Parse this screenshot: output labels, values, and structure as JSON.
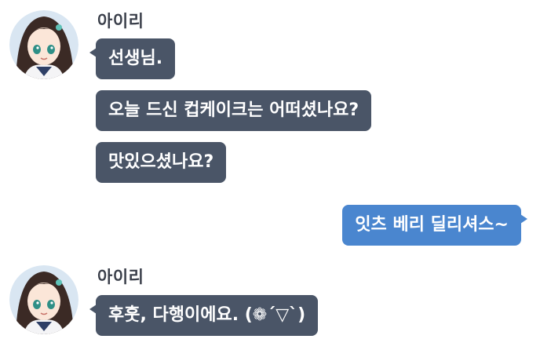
{
  "conversation": {
    "group1": {
      "sender": "아이리",
      "messages": [
        "선생님.",
        "오늘 드신 컵케이크는 어떠셨나요?",
        "맛있으셨나요?"
      ]
    },
    "reply": {
      "message": "잇츠 베리 딜리셔스~"
    },
    "group2": {
      "sender": "아이리",
      "messages": [
        "후훗, 다행이에요. (❁´▽`)"
      ]
    }
  },
  "colors": {
    "incoming_bubble": "#4a5567",
    "outgoing_bubble": "#4a86cf",
    "sender_name": "#3a3f4a",
    "background": "#ffffff"
  },
  "icons": {
    "avatar": "character-portrait-avatar"
  }
}
